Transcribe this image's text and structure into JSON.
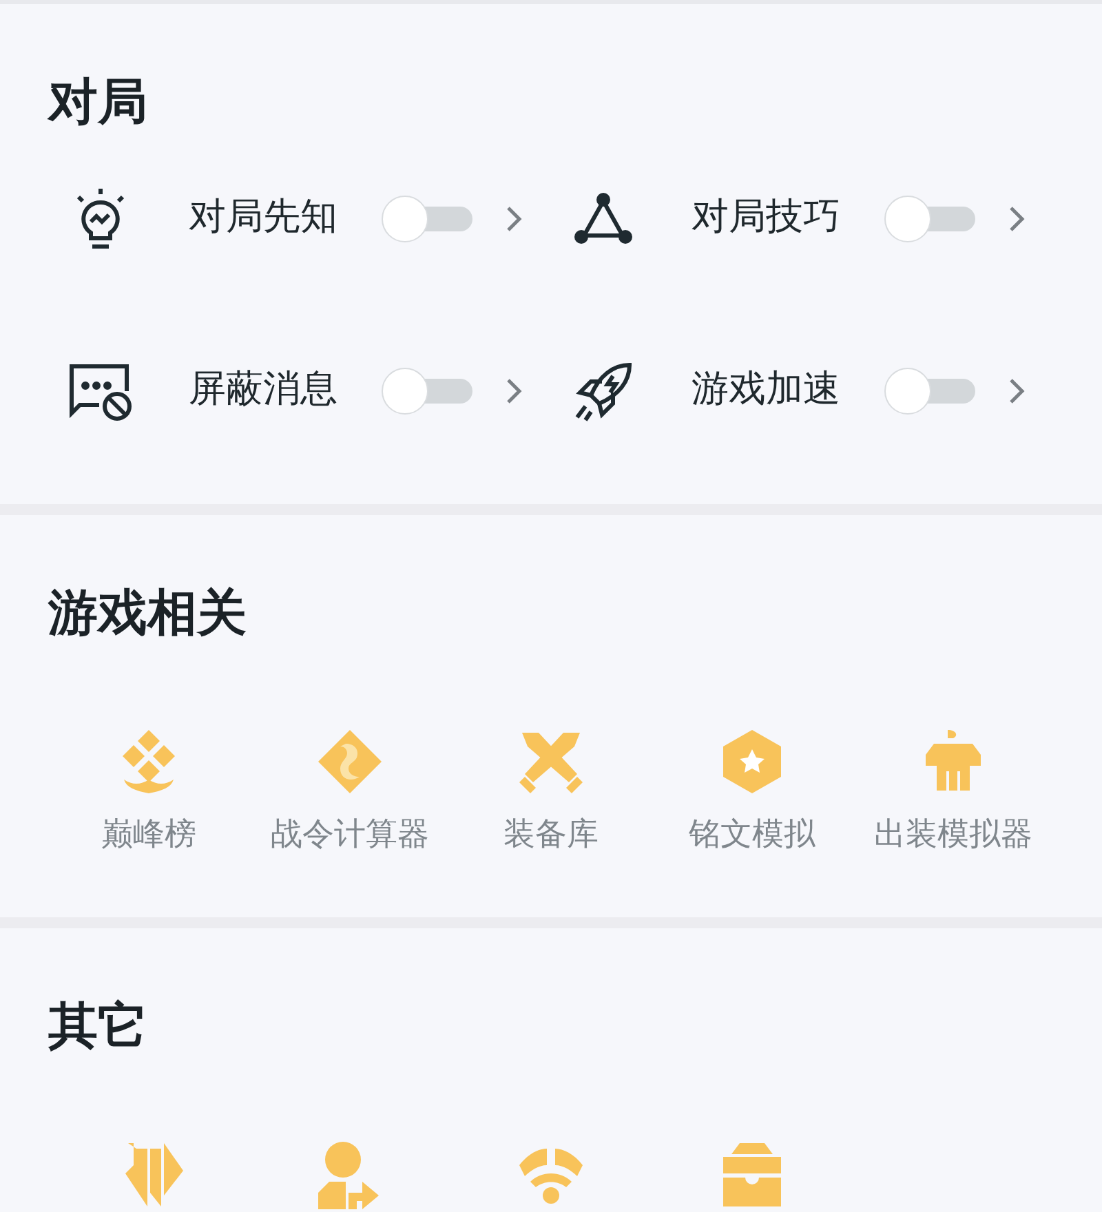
{
  "sections": [
    {
      "title": "对局",
      "kind": "toggles",
      "items": [
        {
          "label": "对局先知",
          "on": false
        },
        {
          "label": "对局技巧",
          "on": false
        },
        {
          "label": "屏蔽消息",
          "on": false
        },
        {
          "label": "游戏加速",
          "on": false
        }
      ]
    },
    {
      "title": "游戏相关",
      "kind": "grid",
      "items": [
        {
          "label": "巅峰榜"
        },
        {
          "label": "战令计算器"
        },
        {
          "label": "装备库"
        },
        {
          "label": "铭文模拟"
        },
        {
          "label": "出装模拟器"
        }
      ]
    },
    {
      "title": "其它",
      "kind": "grid",
      "items": [
        {
          "kind": "icon"
        },
        {
          "kind": "icon"
        },
        {
          "kind": "icon"
        },
        {
          "kind": "icon"
        }
      ]
    }
  ]
}
